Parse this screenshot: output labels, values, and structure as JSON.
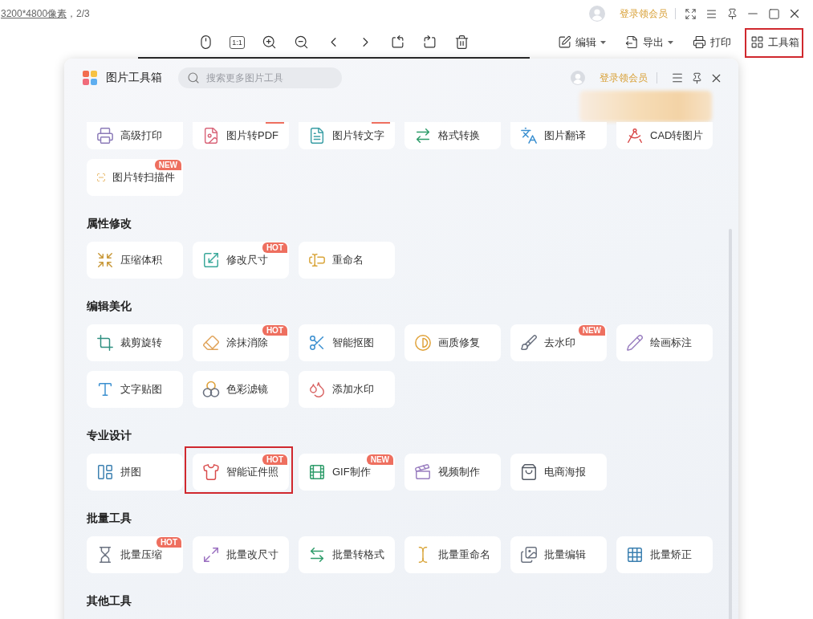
{
  "titlebar": {
    "image_info": "3200*4800像素",
    "page_info": "，2/3",
    "member_link": "登录领会员"
  },
  "toolbar": {
    "actual_size": "1:1",
    "actions": [
      {
        "kind": "menu",
        "label": "编辑",
        "highlighted": false
      },
      {
        "kind": "menu",
        "label": "导出",
        "highlighted": false
      },
      {
        "kind": "button",
        "label": "打印",
        "highlighted": false
      },
      {
        "kind": "button",
        "label": "工具箱",
        "highlighted": true
      }
    ]
  },
  "panel": {
    "title": "图片工具箱",
    "search": {
      "placeholder": "搜索更多图片工具"
    },
    "member_link": "登录领会员",
    "sections": [
      {
        "items": [
          {
            "label": "高级打印",
            "cut": true,
            "badge_cut": false,
            "highlighted": false
          },
          {
            "label": "图片转PDF",
            "cut": true,
            "badge_cut": true,
            "highlighted": false
          },
          {
            "label": "图片转文字",
            "cut": true,
            "badge_cut": true,
            "highlighted": false
          },
          {
            "label": "格式转换",
            "cut": true,
            "badge_cut": false,
            "highlighted": false
          },
          {
            "label": "图片翻译",
            "cut": true,
            "badge_cut": false,
            "highlighted": false
          },
          {
            "label": "CAD转图片",
            "cut": true,
            "badge_cut": false,
            "highlighted": false
          },
          {
            "label": "图片转扫描件",
            "badge": "NEW",
            "cut": false,
            "badge_cut": false,
            "highlighted": false
          }
        ]
      },
      {
        "title": "属性修改",
        "items": [
          {
            "label": "压缩体积",
            "highlighted": false
          },
          {
            "label": "修改尺寸",
            "badge": "HOT",
            "highlighted": false
          },
          {
            "label": "重命名",
            "highlighted": false
          }
        ]
      },
      {
        "title": "编辑美化",
        "items": [
          {
            "label": "裁剪旋转",
            "highlighted": false
          },
          {
            "label": "涂抹消除",
            "badge": "HOT",
            "highlighted": false
          },
          {
            "label": "智能抠图",
            "highlighted": false
          },
          {
            "label": "画质修复",
            "highlighted": false
          },
          {
            "label": "去水印",
            "badge": "NEW",
            "highlighted": false
          },
          {
            "label": "绘画标注",
            "highlighted": false
          },
          {
            "label": "文字贴图",
            "highlighted": false
          },
          {
            "label": "色彩滤镜",
            "highlighted": false
          },
          {
            "label": "添加水印",
            "highlighted": false
          }
        ]
      },
      {
        "title": "专业设计",
        "items": [
          {
            "label": "拼图",
            "highlighted": false
          },
          {
            "label": "智能证件照",
            "badge": "HOT",
            "highlighted": true
          },
          {
            "label": "GIF制作",
            "badge": "NEW",
            "highlighted": false
          },
          {
            "label": "视频制作",
            "highlighted": false
          },
          {
            "label": "电商海报",
            "highlighted": false
          }
        ]
      },
      {
        "title": "批量工具",
        "items": [
          {
            "label": "批量压缩",
            "badge": "HOT",
            "highlighted": false
          },
          {
            "label": "批量改尺寸",
            "highlighted": false
          },
          {
            "label": "批量转格式",
            "highlighted": false
          },
          {
            "label": "批量重命名",
            "highlighted": false
          },
          {
            "label": "批量编辑",
            "highlighted": false
          },
          {
            "label": "批量矫正",
            "highlighted": false
          }
        ]
      },
      {
        "title": "其他工具"
      }
    ]
  }
}
